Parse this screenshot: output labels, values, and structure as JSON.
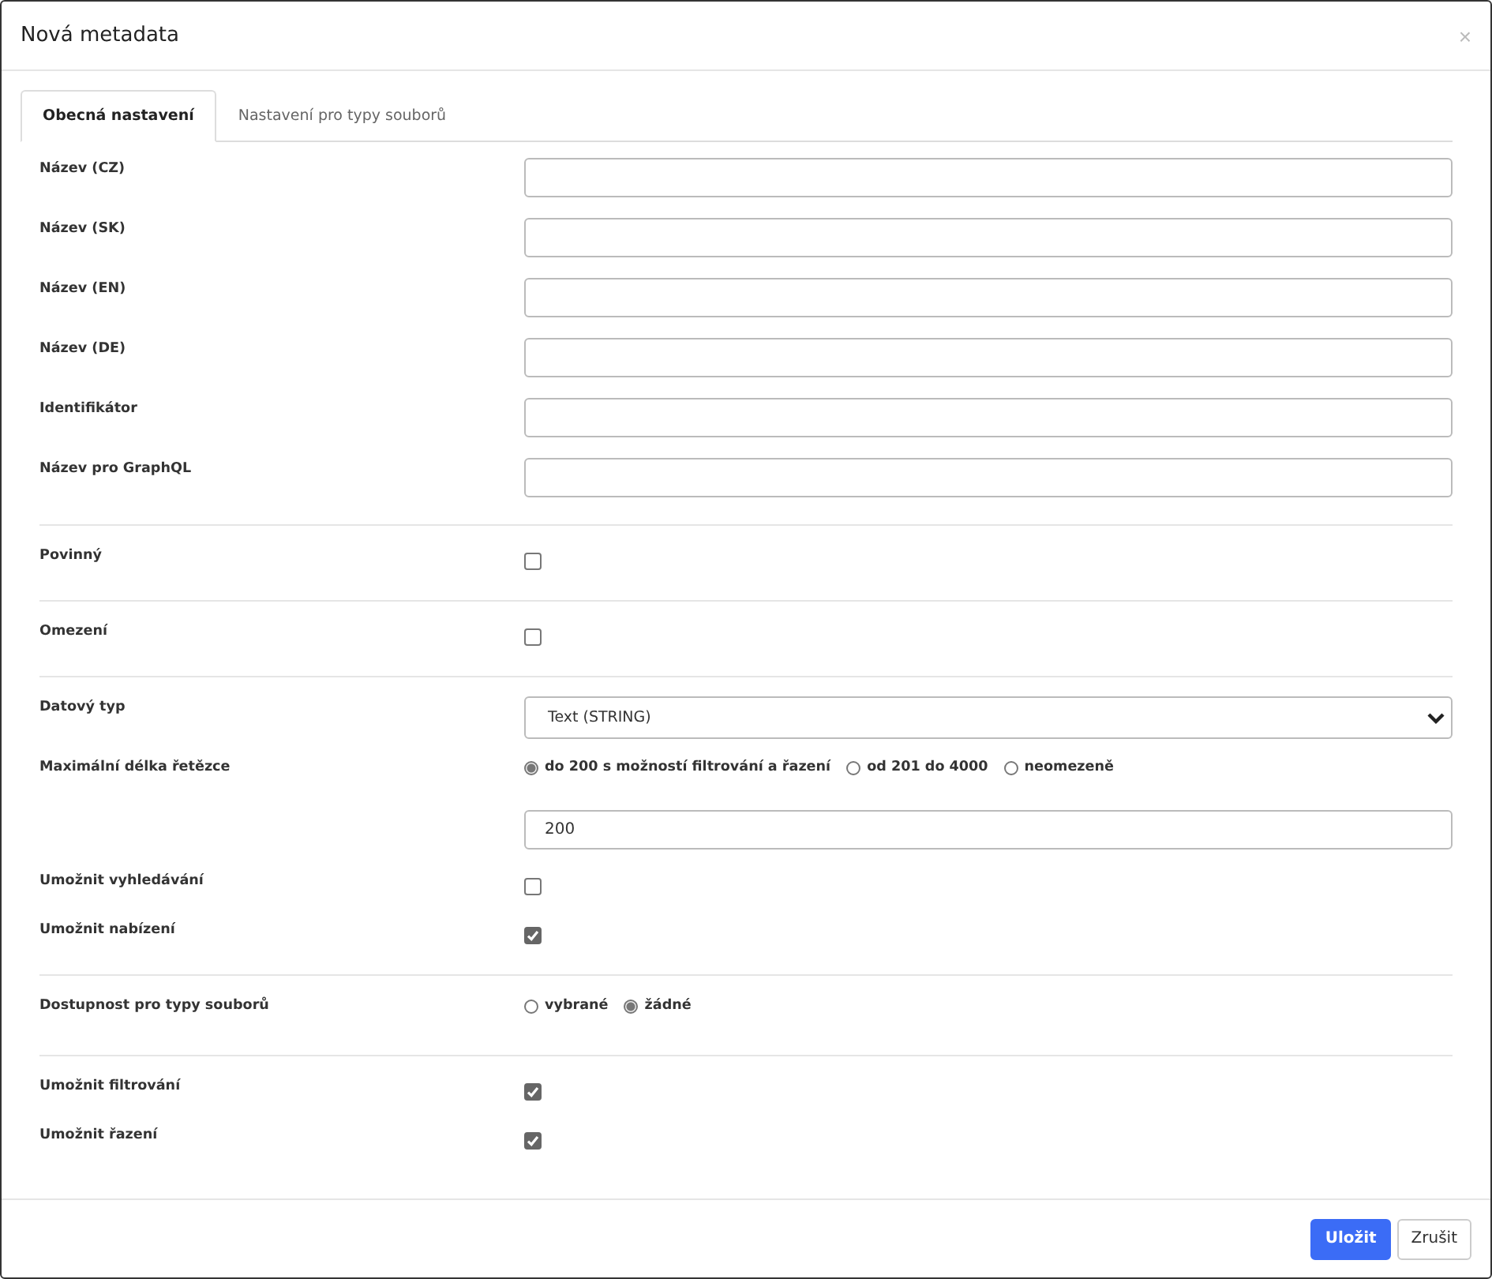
{
  "dialog": {
    "title": "Nová metadata",
    "close": "×"
  },
  "tabs": [
    {
      "label": "Obecná nastavení",
      "selected": true
    },
    {
      "label": "Nastavení pro typy souborů",
      "selected": false
    }
  ],
  "sections": [
    {
      "rows": [
        {
          "label": "Název (CZ)",
          "kind": "text",
          "value": ""
        },
        {
          "label": "Název (SK)",
          "kind": "text",
          "value": ""
        },
        {
          "label": "Název (EN)",
          "kind": "text",
          "value": ""
        },
        {
          "label": "Název (DE)",
          "kind": "text",
          "value": ""
        },
        {
          "label": "Identifikátor",
          "kind": "text",
          "value": ""
        },
        {
          "label": "Název pro GraphQL",
          "kind": "text",
          "value": ""
        }
      ]
    },
    {
      "rows": [
        {
          "label": "Povinný",
          "kind": "checkbox",
          "checked": false
        }
      ]
    },
    {
      "rows": [
        {
          "label": "Omezení",
          "kind": "checkbox",
          "checked": false
        }
      ]
    },
    {
      "rows": [
        {
          "label": "Datový typ",
          "kind": "select",
          "value": "Text (STRING)"
        },
        {
          "label": "Maximální délka řetězce",
          "kind": "radio",
          "options": [
            {
              "label": "do 200 s možností filtrování a řazení",
              "selected": true
            },
            {
              "label": "od 201 do 4000",
              "selected": false
            },
            {
              "label": "neomezeně",
              "selected": false
            }
          ]
        },
        {
          "kind": "text",
          "value": "200"
        },
        {
          "label": "Umožnit vyhledávání",
          "kind": "checkbox",
          "checked": false
        },
        {
          "label": "Umožnit nabízení",
          "kind": "checkbox",
          "checked": true
        }
      ]
    },
    {
      "rows": [
        {
          "label": "Dostupnost pro typy souborů",
          "kind": "radio",
          "options": [
            {
              "label": "vybrané",
              "selected": false
            },
            {
              "label": "žádné",
              "selected": true
            }
          ]
        }
      ]
    },
    {
      "rows": [
        {
          "label": "Umožnit filtrování",
          "kind": "checkbox",
          "checked": true
        },
        {
          "label": "Umožnit řazení",
          "kind": "checkbox",
          "checked": true
        }
      ]
    }
  ],
  "buttons": [
    {
      "label": "Uložit",
      "kind": "primary"
    },
    {
      "label": "Zrušit",
      "kind": "secondary"
    }
  ]
}
